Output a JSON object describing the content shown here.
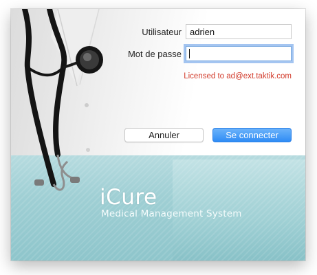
{
  "login": {
    "username_label": "Utilisateur",
    "username_value": "adrien",
    "password_label": "Mot de passe",
    "password_value": "",
    "license_text": "Licensed to ad@ext.taktik.com",
    "cancel_label": "Annuler",
    "connect_label": "Se connecter"
  },
  "branding": {
    "logo": "iCure",
    "tagline": "Medical Management System"
  },
  "colors": {
    "license_text": "#d23a2a",
    "primary_button": "#2f8cf5",
    "focus_ring": "#5a96e6",
    "banner": "#9fcfd4"
  },
  "icons": {
    "illustration": "stethoscope-icon"
  }
}
